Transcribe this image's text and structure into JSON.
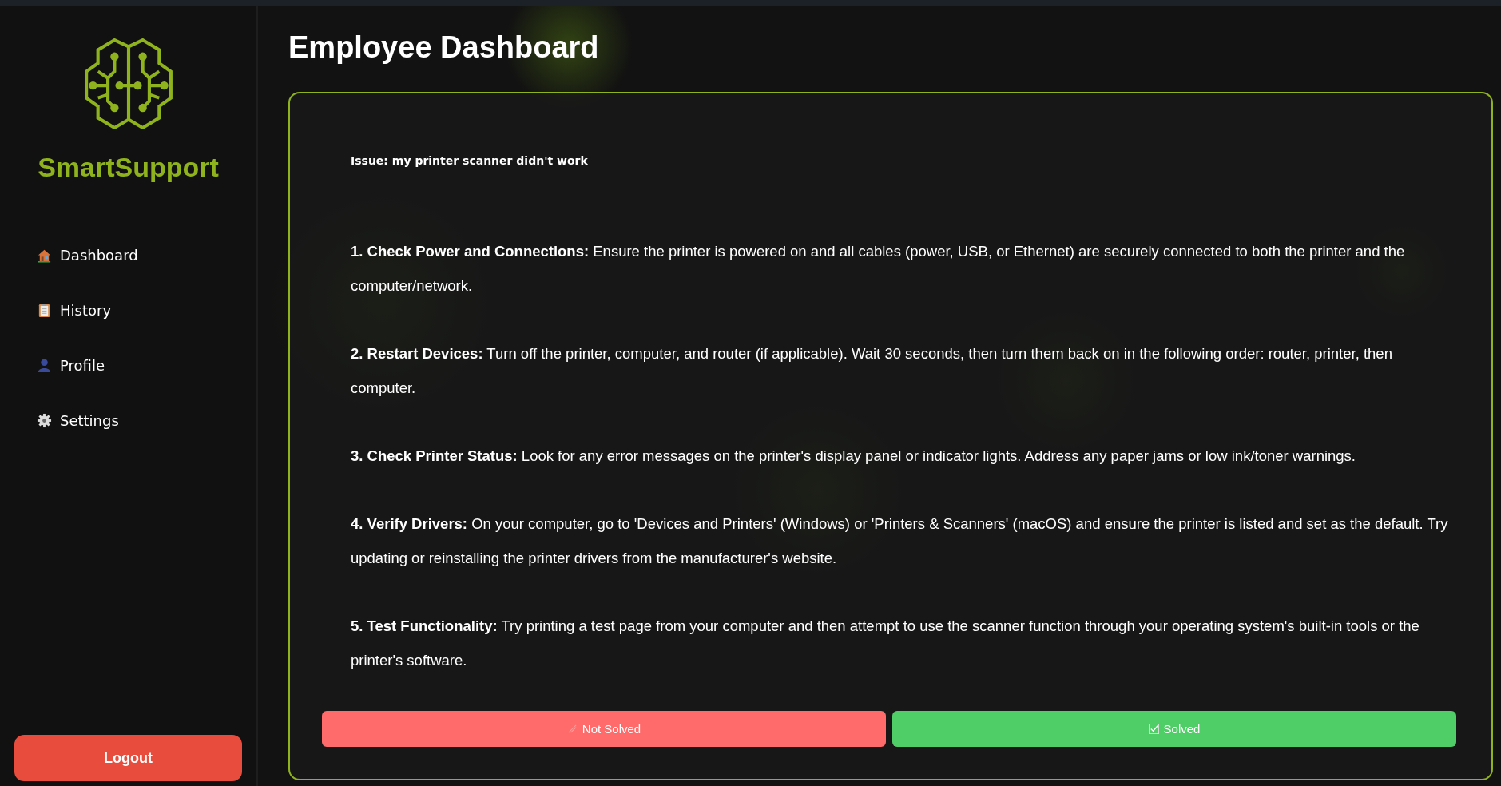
{
  "sidebar": {
    "brand": "SmartSupport",
    "items": [
      {
        "label": "Dashboard"
      },
      {
        "label": "History"
      },
      {
        "label": "Profile"
      },
      {
        "label": "Settings"
      }
    ],
    "logout": "Logout"
  },
  "page": {
    "title": "Employee Dashboard"
  },
  "issue": {
    "text": "Issue: my printer scanner didn't work",
    "steps": [
      "**1. Check Power and Connections:** Ensure the printer is powered on and all cables (power, USB, or Ethernet) are securely connected to both the printer and the computer/network.",
      "**2. Restart Devices:** Turn off the printer, computer, and router (if applicable). Wait 30 seconds, then turn them back on in the following order: router, printer, then computer.",
      "**3. Check Printer Status:** Look for any error messages on the printer's display panel or indicator lights. Address any paper jams or low ink/toner warnings.",
      "**4. Verify Drivers:** On your computer, go to 'Devices and Printers' (Windows) or 'Printers & Scanners' (macOS) and ensure the printer is listed and set as the default. Try updating or reinstalling the printer drivers from the manufacturer's website.",
      "**5. Test Functionality:** Try printing a test page from your computer and then attempt to use the scanner function through your operating system's built-in tools or the printer's software."
    ],
    "actions": [
      {
        "kind": "not_solved",
        "label": "Not Solved"
      },
      {
        "kind": "solved",
        "label": "Solved"
      }
    ]
  }
}
